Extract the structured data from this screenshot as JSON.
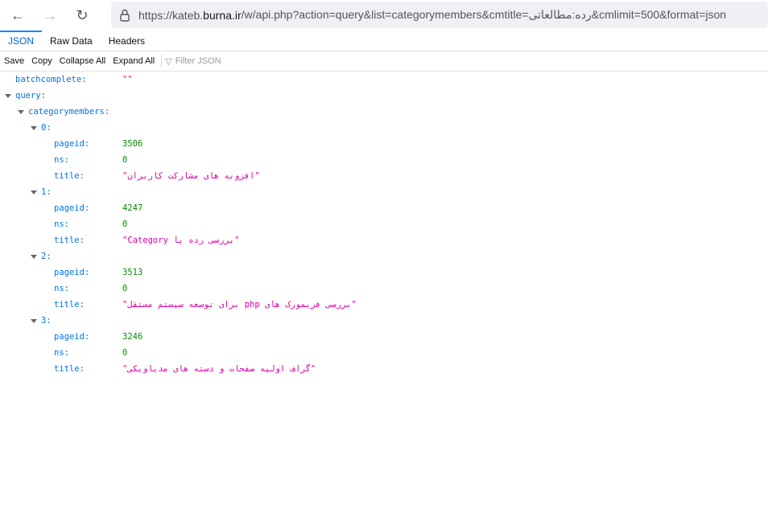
{
  "browser": {
    "url_prefix": "https://kateb.",
    "url_domain": "burna.ir",
    "url_rest": "/w/api.php?action=query&list=categorymembers&cmtitle=رده:مطالعاتی&cmlimit=500&format=json"
  },
  "tabs": [
    {
      "label": "JSON"
    },
    {
      "label": "Raw Data"
    },
    {
      "label": "Headers"
    }
  ],
  "toolbar": {
    "save": "Save",
    "copy": "Copy",
    "collapse_all": "Collapse All",
    "expand_all": "Expand All",
    "filter_placeholder": "Filter JSON"
  },
  "json": {
    "batchcomplete_key": "batchcomplete:",
    "batchcomplete": "",
    "query_key": "query:",
    "categorymembers_key": "categorymembers:",
    "labels": {
      "pageid": "pageid:",
      "ns": "ns:",
      "title": "title:"
    },
    "members": [
      {
        "index": "0:",
        "pageid": "3506",
        "ns": "0",
        "title": "افزونه های مشارکت کاربران"
      },
      {
        "index": "1:",
        "pageid": "4247",
        "ns": "0",
        "title": "بررسی رده یا Category"
      },
      {
        "index": "2:",
        "pageid": "3513",
        "ns": "0",
        "title": "بررسی فریمورک های php برای توسعه سیستم مستقل"
      },
      {
        "index": "3:",
        "pageid": "3246",
        "ns": "0",
        "title": "گراف اولیه صفحات و دسته های مدیاویکی"
      }
    ]
  }
}
